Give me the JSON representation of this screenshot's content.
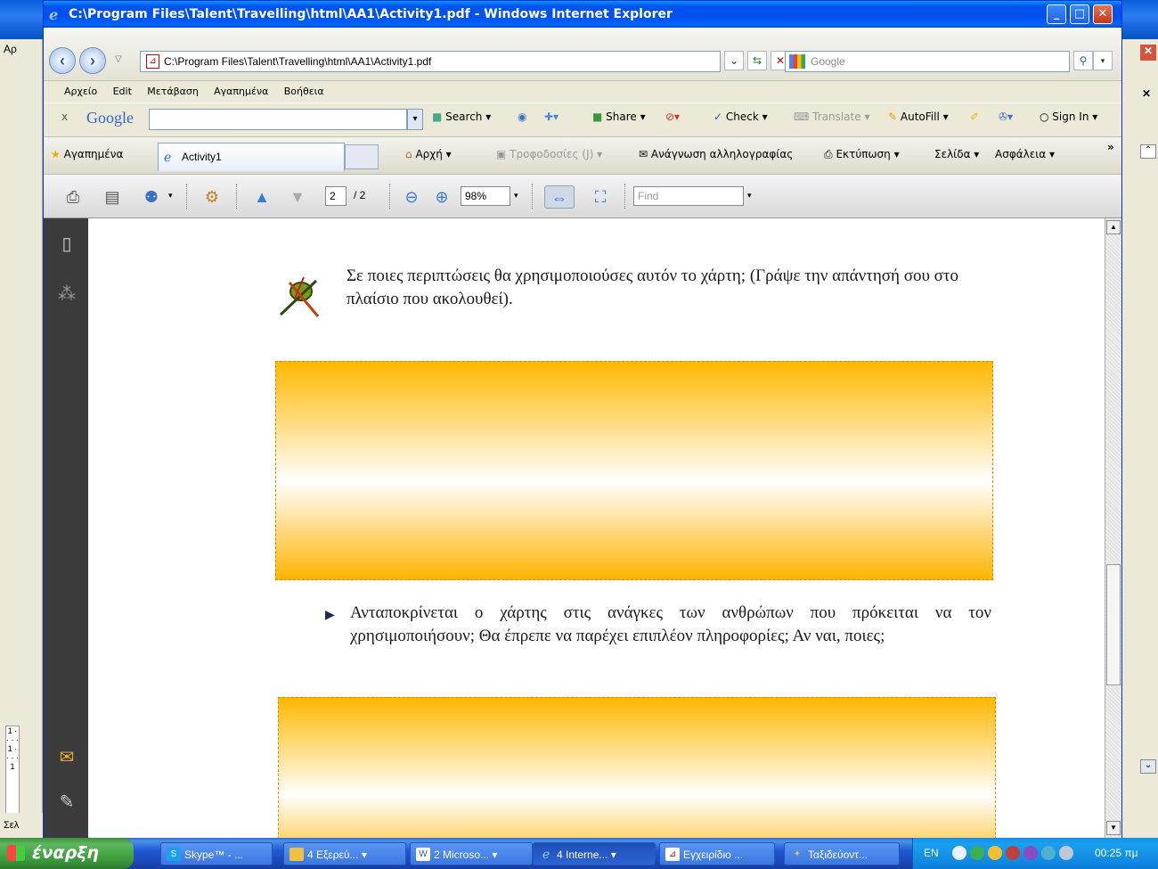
{
  "background_window": {
    "left_fragments": [
      "Αρ",
      "Σελ"
    ],
    "ruler_marks": "1 · · · · 1 · · · · 1"
  },
  "window": {
    "title": "C:\\Program Files\\Talent\\Travelling\\html\\AA1\\Activity1.pdf - Windows Internet Explorer",
    "address": "C:\\Program Files\\Talent\\Travelling\\html\\AA1\\Activity1.pdf",
    "search_placeholder": "Google",
    "minimize": "_",
    "maximize": "□",
    "close": "✕"
  },
  "menu": [
    "Αρχείο",
    "Edit",
    "Μετάβαση",
    "Αγαπημένα",
    "Βοήθεια"
  ],
  "google_toolbar": {
    "close": "x",
    "logo": "Google",
    "search": "Search",
    "share": "Share",
    "check": "Check",
    "translate": "Translate",
    "autofill": "AutoFill",
    "signin": "Sign In"
  },
  "tabs": {
    "favorites": "Αγαπημένα",
    "active_tab": "Activity1",
    "home": "Αρχή",
    "feeds": "Τροφοδοσίες (J)",
    "mail": "Ανάγνωση αλληλογραφίας",
    "print": "Εκτύπωση",
    "page": "Σελίδα",
    "safety": "Ασφάλεια",
    "more": "»"
  },
  "pdf_toolbar": {
    "page_current": "2",
    "page_total": "/ 2",
    "zoom": "98%",
    "find_placeholder": "Find"
  },
  "document": {
    "question1": "Σε ποιες περιπτώσεις θα χρησιμοποιούσες αυτόν το χάρτη; (Γράψε την απάντησή σου στο πλαίσιο που ακολουθεί).",
    "bullet": "▶",
    "question2": "Ανταποκρίνεται ο χάρτης στις ανάγκες των ανθρώπων που πρόκειται να τον χρησιμοποιήσουν; Θα έπρεπε να παρέχει επιπλέον πληροφορίες; Αν ναι, ποιες;"
  },
  "taskbar": {
    "start": "έναρξη",
    "tasks": [
      {
        "label": "Skype™ - ...",
        "icon": "skype-icon"
      },
      {
        "label": "4 Εξερεύ...",
        "icon": "folder-icon"
      },
      {
        "label": "2 Microso...",
        "icon": "word-icon"
      },
      {
        "label": "4 Interne...",
        "icon": "ie-icon"
      },
      {
        "label": "Εγχειρίδιο ...",
        "icon": "pdf-icon"
      },
      {
        "label": "Ταξιδεύοντ...",
        "icon": "app-icon"
      }
    ],
    "lang": "EN",
    "clock": "00:25 πμ"
  },
  "colors": {
    "answer_box_orange": "#ffb800",
    "taskbar_blue": "#245edb",
    "start_green": "#3b9a3b"
  }
}
